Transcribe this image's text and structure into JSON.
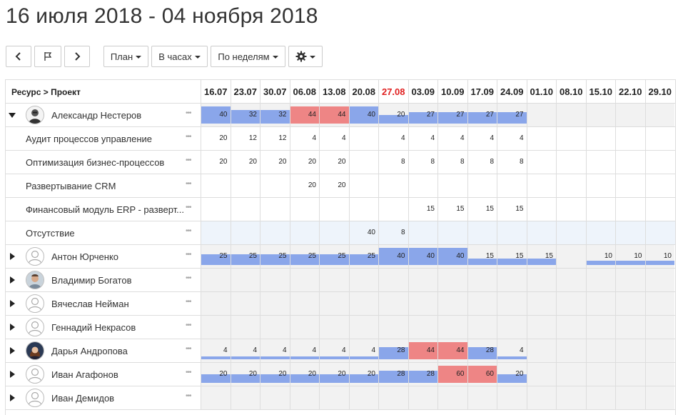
{
  "title": "16 июля 2018 - 04 ноября 2018",
  "toolbar": {
    "plan_label": "План",
    "units_label": "В часах",
    "period_label": "По неделям"
  },
  "header": {
    "resource_label": "Ресурс > Проект",
    "weeks": [
      "16.07",
      "23.07",
      "30.07",
      "06.08",
      "13.08",
      "20.08",
      "27.08",
      "03.09",
      "10.09",
      "17.09",
      "24.09",
      "01.10",
      "08.10",
      "15.10",
      "22.10",
      "29.10"
    ],
    "current_week_index": 6
  },
  "colors": {
    "ok": "#8aa6ea",
    "over": "#ee8585",
    "current_week": "#e02020"
  },
  "rows": [
    {
      "kind": "resource",
      "name": "Александр Нестеров",
      "expanded": true,
      "avatar": "photo-bw",
      "cells": [
        {
          "v": "40",
          "level": "full",
          "status": "ok"
        },
        {
          "v": "32",
          "level": "0.8",
          "status": "ok"
        },
        {
          "v": "32",
          "level": "0.8",
          "status": "ok"
        },
        {
          "v": "44",
          "level": "full",
          "status": "over"
        },
        {
          "v": "44",
          "level": "full",
          "status": "over"
        },
        {
          "v": "40",
          "level": "full",
          "status": "ok"
        },
        {
          "v": "20",
          "level": "0.5",
          "status": "ok"
        },
        {
          "v": "27",
          "level": "0.68",
          "status": "ok"
        },
        {
          "v": "27",
          "level": "0.68",
          "status": "ok"
        },
        {
          "v": "27",
          "level": "0.68",
          "status": "ok"
        },
        {
          "v": "27",
          "level": "0.68",
          "status": "ok"
        },
        {
          "v": "",
          "level": "0",
          "status": "none"
        },
        {
          "v": "",
          "level": "0",
          "status": "none"
        },
        {
          "v": "",
          "level": "0",
          "status": "none"
        },
        {
          "v": "",
          "level": "0",
          "status": "none"
        },
        {
          "v": "",
          "level": "0",
          "status": "none"
        }
      ]
    },
    {
      "kind": "project",
      "name": "Аудит процессов управление",
      "cells": [
        "20",
        "12",
        "12",
        "4",
        "4",
        "",
        "4",
        "4",
        "4",
        "4",
        "4",
        "",
        "",
        "",
        "",
        ""
      ]
    },
    {
      "kind": "project",
      "name": "Оптимизация бизнес-процессов",
      "cells": [
        "20",
        "20",
        "20",
        "20",
        "20",
        "",
        "8",
        "8",
        "8",
        "8",
        "8",
        "",
        "",
        "",
        "",
        ""
      ]
    },
    {
      "kind": "project",
      "name": "Развертывание CRM",
      "cells": [
        "",
        "",
        "",
        "20",
        "20",
        "",
        "",
        "",
        "",
        "",
        "",
        "",
        "",
        "",
        "",
        ""
      ]
    },
    {
      "kind": "project",
      "name": "Финансовый модуль ERP - разверт...",
      "cells": [
        "",
        "",
        "",
        "",
        "",
        "",
        "",
        "15",
        "15",
        "15",
        "15",
        "",
        "",
        "",
        "",
        ""
      ]
    },
    {
      "kind": "absence",
      "name": "Отсутствие",
      "cells": [
        "",
        "",
        "",
        "",
        "",
        "40",
        "8",
        "",
        "",
        "",
        "",
        "",
        "",
        "",
        "",
        ""
      ]
    },
    {
      "kind": "resource",
      "name": "Антон Юрченко",
      "expanded": false,
      "avatar": "placeholder",
      "cells": [
        {
          "v": "25",
          "level": "0.62",
          "status": "ok"
        },
        {
          "v": "25",
          "level": "0.62",
          "status": "ok"
        },
        {
          "v": "25",
          "level": "0.62",
          "status": "ok"
        },
        {
          "v": "25",
          "level": "0.62",
          "status": "ok"
        },
        {
          "v": "25",
          "level": "0.62",
          "status": "ok"
        },
        {
          "v": "25",
          "level": "0.62",
          "status": "ok"
        },
        {
          "v": "40",
          "level": "full",
          "status": "ok"
        },
        {
          "v": "40",
          "level": "full",
          "status": "ok"
        },
        {
          "v": "40",
          "level": "full",
          "status": "ok"
        },
        {
          "v": "15",
          "level": "0.37",
          "status": "ok"
        },
        {
          "v": "15",
          "level": "0.37",
          "status": "ok"
        },
        {
          "v": "15",
          "level": "0.37",
          "status": "ok"
        },
        {
          "v": "",
          "level": "0",
          "status": "none"
        },
        {
          "v": "10",
          "level": "0.25",
          "status": "ok"
        },
        {
          "v": "10",
          "level": "0.25",
          "status": "ok"
        },
        {
          "v": "10",
          "level": "0.25",
          "status": "ok"
        }
      ]
    },
    {
      "kind": "resource",
      "name": "Владимир Богатов",
      "expanded": false,
      "avatar": "photo-color",
      "cells": []
    },
    {
      "kind": "resource",
      "name": "Вячеслав Нейман",
      "expanded": false,
      "avatar": "placeholder",
      "cells": []
    },
    {
      "kind": "resource",
      "name": "Геннадий Некрасов",
      "expanded": false,
      "avatar": "placeholder",
      "cells": []
    },
    {
      "kind": "resource",
      "name": "Дарья Андропова",
      "expanded": false,
      "avatar": "photo-woman",
      "cells": [
        {
          "v": "4",
          "level": "0.1",
          "status": "ok"
        },
        {
          "v": "4",
          "level": "0.1",
          "status": "ok"
        },
        {
          "v": "4",
          "level": "0.1",
          "status": "ok"
        },
        {
          "v": "4",
          "level": "0.1",
          "status": "ok"
        },
        {
          "v": "4",
          "level": "0.1",
          "status": "ok"
        },
        {
          "v": "4",
          "level": "0.1",
          "status": "ok"
        },
        {
          "v": "28",
          "level": "0.7",
          "status": "ok"
        },
        {
          "v": "44",
          "level": "full",
          "status": "over"
        },
        {
          "v": "44",
          "level": "full",
          "status": "over"
        },
        {
          "v": "28",
          "level": "0.7",
          "status": "ok"
        },
        {
          "v": "4",
          "level": "0.1",
          "status": "ok"
        },
        {
          "v": "",
          "level": "0",
          "status": "none"
        },
        {
          "v": "",
          "level": "0",
          "status": "none"
        },
        {
          "v": "",
          "level": "0",
          "status": "none"
        },
        {
          "v": "",
          "level": "0",
          "status": "none"
        },
        {
          "v": "",
          "level": "0",
          "status": "none"
        }
      ]
    },
    {
      "kind": "resource",
      "name": "Иван Агафонов",
      "expanded": false,
      "avatar": "placeholder",
      "cells": [
        {
          "v": "20",
          "level": "0.5",
          "status": "ok"
        },
        {
          "v": "20",
          "level": "0.5",
          "status": "ok"
        },
        {
          "v": "20",
          "level": "0.5",
          "status": "ok"
        },
        {
          "v": "20",
          "level": "0.5",
          "status": "ok"
        },
        {
          "v": "20",
          "level": "0.5",
          "status": "ok"
        },
        {
          "v": "20",
          "level": "0.5",
          "status": "ok"
        },
        {
          "v": "28",
          "level": "0.7",
          "status": "ok"
        },
        {
          "v": "28",
          "level": "0.7",
          "status": "ok"
        },
        {
          "v": "60",
          "level": "full",
          "status": "over"
        },
        {
          "v": "60",
          "level": "full",
          "status": "over"
        },
        {
          "v": "20",
          "level": "0.5",
          "status": "ok"
        },
        {
          "v": "",
          "level": "0",
          "status": "none"
        },
        {
          "v": "",
          "level": "0",
          "status": "none"
        },
        {
          "v": "",
          "level": "0",
          "status": "none"
        },
        {
          "v": "",
          "level": "0",
          "status": "none"
        },
        {
          "v": "",
          "level": "0",
          "status": "none"
        }
      ]
    },
    {
      "kind": "resource",
      "name": "Иван Демидов",
      "expanded": false,
      "avatar": "placeholder",
      "cells": []
    }
  ]
}
